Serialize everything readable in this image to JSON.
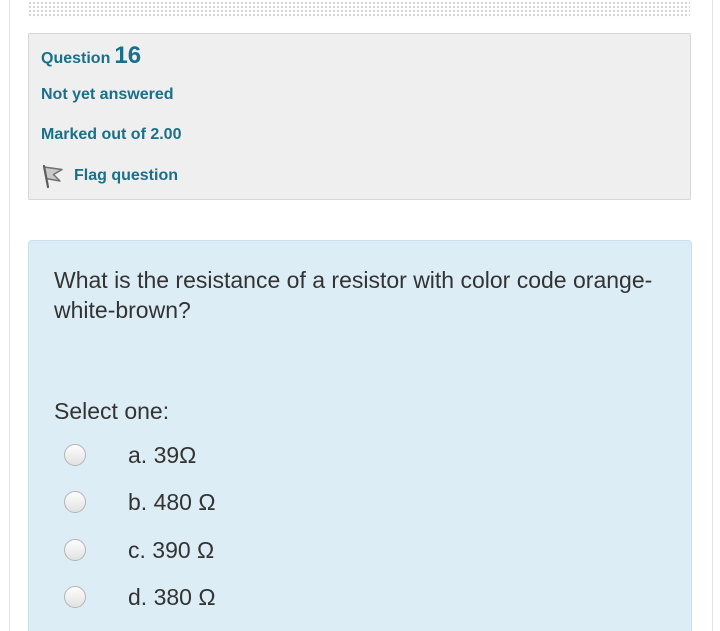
{
  "question_info": {
    "label": "Question",
    "number": "16",
    "state": "Not yet answered",
    "grade": "Marked out of 2.00",
    "flag_label": "Flag question"
  },
  "question": {
    "text": "What is the resistance of a resistor with color code orange-white-brown?",
    "prompt": "Select one:",
    "answers": [
      {
        "label": "a. 39Ω"
      },
      {
        "label": "b. 480 Ω"
      },
      {
        "label": "c. 390 Ω"
      },
      {
        "label": "d. 380 Ω"
      }
    ]
  },
  "colors": {
    "accent_text": "#1a6f8a",
    "info_background": "#efefef",
    "content_background": "#dcedf5",
    "body_text": "#333333"
  },
  "icons": {
    "flag": "flag-icon",
    "radio": "radio-button"
  }
}
